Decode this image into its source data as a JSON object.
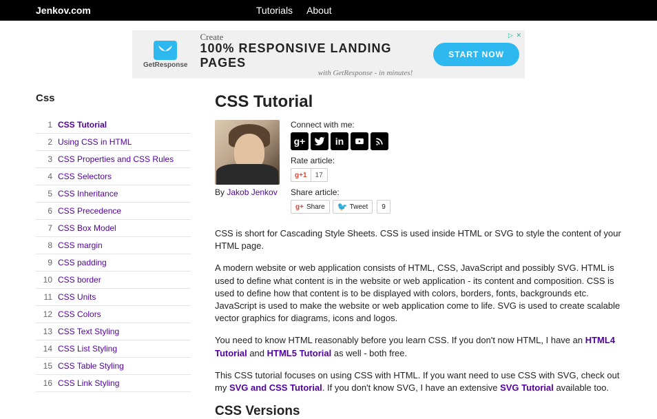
{
  "topbar": {
    "brand": "Jenkov.com",
    "nav": [
      "Tutorials",
      "About"
    ]
  },
  "ad": {
    "close": "▷ ✕",
    "logo_text": "GetResponse",
    "create": "Create",
    "headline": "100% RESPONSIVE LANDING PAGES",
    "sub": "with GetResponse - in minutes!",
    "cta": "START NOW"
  },
  "sidebar": {
    "title": "Css",
    "items": [
      {
        "n": "1",
        "label": "CSS Tutorial",
        "active": true
      },
      {
        "n": "2",
        "label": "Using CSS in HTML"
      },
      {
        "n": "3",
        "label": "CSS Properties and CSS Rules"
      },
      {
        "n": "4",
        "label": "CSS Selectors"
      },
      {
        "n": "5",
        "label": "CSS Inheritance"
      },
      {
        "n": "6",
        "label": "CSS Precedence"
      },
      {
        "n": "7",
        "label": "CSS Box Model"
      },
      {
        "n": "8",
        "label": "CSS margin"
      },
      {
        "n": "9",
        "label": "CSS padding"
      },
      {
        "n": "10",
        "label": "CSS border"
      },
      {
        "n": "11",
        "label": "CSS Units"
      },
      {
        "n": "12",
        "label": "CSS Colors"
      },
      {
        "n": "13",
        "label": "CSS Text Styling"
      },
      {
        "n": "14",
        "label": "CSS List Styling"
      },
      {
        "n": "15",
        "label": "CSS Table Styling"
      },
      {
        "n": "16",
        "label": "CSS Link Styling"
      }
    ]
  },
  "main": {
    "title": "CSS Tutorial",
    "byline_prefix": "By ",
    "author": "Jakob Jenkov",
    "connect_label": "Connect with me:",
    "rate_label": "Rate article:",
    "share_label": "Share article:",
    "gplus_label": "+1",
    "gplus_count": "17",
    "gshare_label": "Share",
    "tweet_label": "Tweet",
    "tweet_count": "9",
    "social_icons": [
      "googleplus",
      "twitter",
      "linkedin",
      "youtube",
      "rss"
    ],
    "para1": "CSS is short for Cascading Style Sheets. CSS is used inside HTML or SVG to style the content of your HTML page.",
    "para2": "A modern website or web application consists of HTML, CSS, JavaScript and possibly SVG. HTML is used to define what content is in the website or web application - its content and composition. CSS is used to define how that content is to be displayed with colors, borders, fonts, backgrounds etc. JavaScript is used to make the website or web application come to life. SVG is used to create scalable vector graphics for diagrams, icons and logos.",
    "para3_a": "You need to know HTML reasonably before you learn CSS. If you don't now HTML, I have an ",
    "para3_link1": "HTML4 Tutorial",
    "para3_b": " and ",
    "para3_link2": "HTML5 Tutorial",
    "para3_c": " as well - both free.",
    "para4_a": "This CSS tutorial focuses on using CSS with HTML. If you want need to use CSS with SVG, check out my ",
    "para4_link1": "SVG and CSS Tutorial",
    "para4_b": ". If you don't know SVG, I have an extensive ",
    "para4_link2": "SVG Tutorial",
    "para4_c": " available too.",
    "h2": "CSS Versions"
  }
}
